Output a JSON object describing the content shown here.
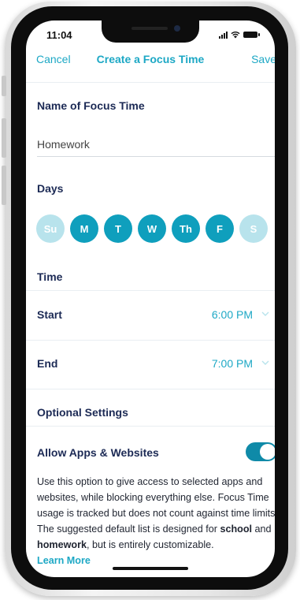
{
  "status_bar": {
    "time": "11:04"
  },
  "nav": {
    "cancel": "Cancel",
    "title": "Create a Focus Time",
    "save": "Save"
  },
  "name_section": {
    "heading": "Name of Focus Time",
    "value": "Homework"
  },
  "days_section": {
    "heading": "Days",
    "days": [
      {
        "label": "Su",
        "selected": false
      },
      {
        "label": "M",
        "selected": true
      },
      {
        "label": "T",
        "selected": true
      },
      {
        "label": "W",
        "selected": true
      },
      {
        "label": "Th",
        "selected": true
      },
      {
        "label": "F",
        "selected": true
      },
      {
        "label": "S",
        "selected": false
      }
    ]
  },
  "time_section": {
    "heading": "Time",
    "start": {
      "label": "Start",
      "value": "6:00 PM"
    },
    "end": {
      "label": "End",
      "value": "7:00 PM"
    }
  },
  "optional": {
    "heading": "Optional Settings",
    "allow_label": "Allow Apps & Websites",
    "allow_enabled": true,
    "description_1": "Use this option to give access to selected apps and websites, while blocking everything else. Focus Time usage is tracked but does not count against time limits. The suggested default list is designed for ",
    "bold_1": "school",
    "description_2": " and ",
    "bold_2": "homework",
    "description_3": ", but is entirely customizable.",
    "learn_more": "Learn More"
  },
  "colors": {
    "accent": "#1da8c5",
    "day_on": "#0f9fbd",
    "day_off": "#b8e3ec",
    "heading": "#1c2a55",
    "toggle": "#0f8aa8"
  },
  "icons": {
    "chevron": "chevron-down-icon",
    "signal": "signal-icon",
    "wifi": "wifi-icon",
    "battery": "battery-icon"
  }
}
